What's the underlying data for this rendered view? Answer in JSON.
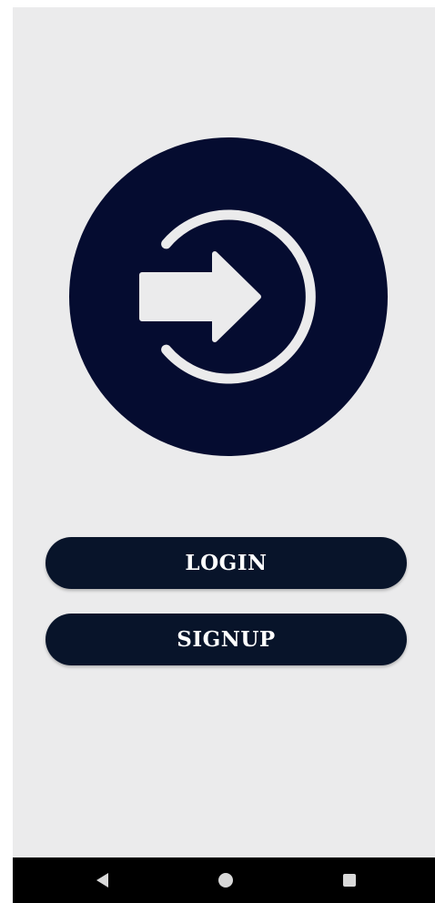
{
  "icons": {
    "logo": "login-arrow-icon"
  },
  "colors": {
    "background": "#ebebec",
    "logo_circle": "#050c30",
    "logo_glyph": "#ebebec",
    "button_bg": "#08142a",
    "button_text": "#ffffff",
    "nav_bar": "#000000",
    "nav_icon": "#d9d9d9"
  },
  "buttons": {
    "login_label": "LOGIN",
    "signup_label": "SIGNUP"
  },
  "nav": {
    "back_icon": "back-triangle-icon",
    "home_icon": "home-circle-icon",
    "recent_icon": "recent-apps-square-icon"
  }
}
